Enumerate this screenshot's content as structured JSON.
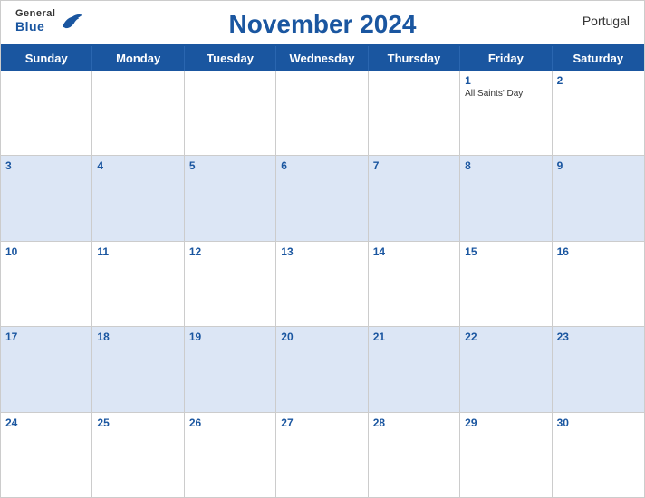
{
  "header": {
    "title": "November 2024",
    "country": "Portugal",
    "logo": {
      "general": "General",
      "blue": "Blue"
    }
  },
  "dayHeaders": [
    "Sunday",
    "Monday",
    "Tuesday",
    "Wednesday",
    "Thursday",
    "Friday",
    "Saturday"
  ],
  "weeks": [
    [
      {
        "num": "",
        "holiday": ""
      },
      {
        "num": "",
        "holiday": ""
      },
      {
        "num": "",
        "holiday": ""
      },
      {
        "num": "",
        "holiday": ""
      },
      {
        "num": "",
        "holiday": ""
      },
      {
        "num": "1",
        "holiday": "All Saints' Day"
      },
      {
        "num": "2",
        "holiday": ""
      }
    ],
    [
      {
        "num": "3",
        "holiday": ""
      },
      {
        "num": "4",
        "holiday": ""
      },
      {
        "num": "5",
        "holiday": ""
      },
      {
        "num": "6",
        "holiday": ""
      },
      {
        "num": "7",
        "holiday": ""
      },
      {
        "num": "8",
        "holiday": ""
      },
      {
        "num": "9",
        "holiday": ""
      }
    ],
    [
      {
        "num": "10",
        "holiday": ""
      },
      {
        "num": "11",
        "holiday": ""
      },
      {
        "num": "12",
        "holiday": ""
      },
      {
        "num": "13",
        "holiday": ""
      },
      {
        "num": "14",
        "holiday": ""
      },
      {
        "num": "15",
        "holiday": ""
      },
      {
        "num": "16",
        "holiday": ""
      }
    ],
    [
      {
        "num": "17",
        "holiday": ""
      },
      {
        "num": "18",
        "holiday": ""
      },
      {
        "num": "19",
        "holiday": ""
      },
      {
        "num": "20",
        "holiday": ""
      },
      {
        "num": "21",
        "holiday": ""
      },
      {
        "num": "22",
        "holiday": ""
      },
      {
        "num": "23",
        "holiday": ""
      }
    ],
    [
      {
        "num": "24",
        "holiday": ""
      },
      {
        "num": "25",
        "holiday": ""
      },
      {
        "num": "26",
        "holiday": ""
      },
      {
        "num": "27",
        "holiday": ""
      },
      {
        "num": "28",
        "holiday": ""
      },
      {
        "num": "29",
        "holiday": ""
      },
      {
        "num": "30",
        "holiday": ""
      }
    ]
  ]
}
